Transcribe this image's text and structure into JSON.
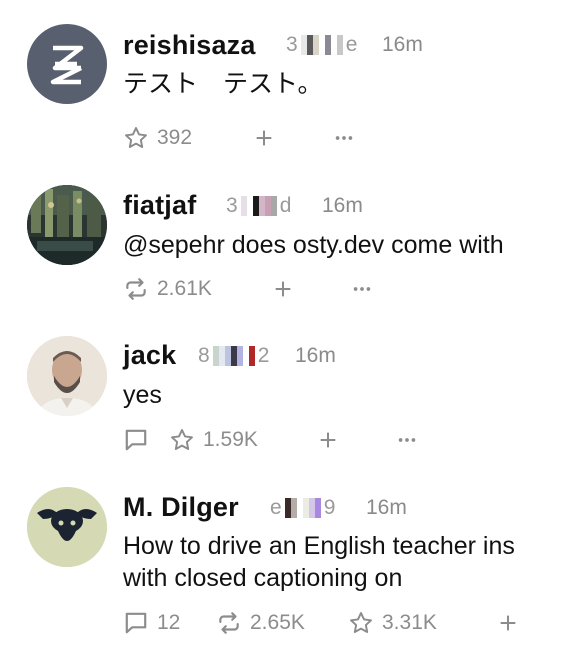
{
  "posts": [
    {
      "name": "reishisaza",
      "npub_start": "3",
      "npub_end": "e",
      "npub_colors": [
        "#e8e8e8",
        "#5a5a5a",
        "#d8d4c8",
        "#ffffff",
        "#8a8a94",
        "#ffffff",
        "#c8c8c8"
      ],
      "time": "16m",
      "content": [
        "テスト　テスト。"
      ],
      "like_count": "392",
      "actions": [
        "star-icon",
        "plus-icon",
        "ellipsis-icon"
      ]
    },
    {
      "name": "fiatjaf",
      "npub_start": "3",
      "npub_end": "d",
      "npub_colors": [
        "#e6dfe8",
        "#ffffff",
        "#1a1a1a",
        "#d4b6c8",
        "#c8a0b4",
        "#a8a8a8"
      ],
      "time": "16m",
      "content": [
        "@sepehr does osty.dev come with"
      ],
      "repost_count": "2.61K",
      "actions": [
        "repost-icon",
        "plus-icon",
        "ellipsis-icon"
      ]
    },
    {
      "name": "jack",
      "npub_start": "8",
      "npub_end": "2",
      "npub_colors": [
        "#c8d4cc",
        "#e4e8f0",
        "#bcc4e0",
        "#3a3a48",
        "#b4b4e4",
        "#ffffff",
        "#b02828"
      ],
      "time": "16m",
      "content": [
        "yes"
      ],
      "like_count": "1.59K",
      "actions": [
        "reply-icon",
        "star-icon",
        "plus-icon",
        "ellipsis-icon"
      ]
    },
    {
      "name": "M. Dilger",
      "npub_start": "e",
      "npub_end": "9",
      "npub_colors": [
        "#3a2a2a",
        "#b4aca8",
        "#ffffff",
        "#ecece4",
        "#d4c8e8",
        "#a888e0"
      ],
      "time": "16m",
      "content": [
        "How to drive an English teacher ins",
        "with closed captioning on"
      ],
      "reply_count": "12",
      "repost_count": "2.65K",
      "like_count": "3.31K",
      "actions": [
        "reply-icon",
        "repost-icon",
        "star-icon",
        "plus-icon"
      ]
    }
  ],
  "colors": {
    "text": "#111111",
    "muted": "#8c8c8c",
    "background": "#ffffff"
  }
}
